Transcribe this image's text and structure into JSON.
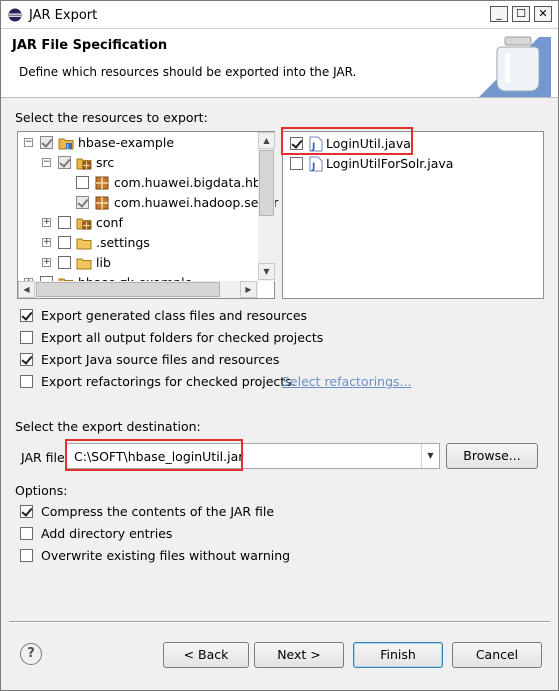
{
  "window": {
    "title": "JAR Export"
  },
  "banner": {
    "title": "JAR File Specification",
    "description": "Define which resources should be exported into the JAR."
  },
  "resources": {
    "label": "Select the resources to export:",
    "tree": [
      {
        "label": "hbase-example",
        "state": "grey-checked",
        "expander": "−",
        "icon": "project-icon"
      },
      {
        "label": "src",
        "state": "grey-checked",
        "expander": "−",
        "icon": "package-folder-icon"
      },
      {
        "label": "com.huawei.bigdata.hbas",
        "state": "unchecked",
        "expander": "",
        "icon": "package-icon"
      },
      {
        "label": "com.huawei.hadoop.secur",
        "state": "grey-checked",
        "expander": "",
        "icon": "package-icon"
      },
      {
        "label": "conf",
        "state": "unchecked",
        "expander": "+",
        "icon": "package-folder-icon"
      },
      {
        "label": ".settings",
        "state": "unchecked",
        "expander": "+",
        "icon": "folder-icon"
      },
      {
        "label": "lib",
        "state": "unchecked",
        "expander": "+",
        "icon": "folder-icon"
      },
      {
        "label": "hbase-zk-example",
        "state": "unchecked",
        "expander": "+",
        "icon": "project-icon"
      }
    ],
    "files": [
      {
        "label": "LoginUtil.java",
        "checked": true
      },
      {
        "label": "LoginUtilForSolr.java",
        "checked": false
      }
    ]
  },
  "options_export": [
    {
      "label": "Export generated class files and resources",
      "checked": true
    },
    {
      "label": "Export all output folders for checked projects",
      "checked": false
    },
    {
      "label": "Export Java source files and resources",
      "checked": true
    },
    {
      "label": "Export refactorings for checked projects.",
      "checked": false,
      "link": "Select refactorings..."
    }
  ],
  "destination": {
    "label": "Select the export destination:",
    "jar_label": "JAR file:",
    "jar_value": "C:\\SOFT\\hbase_loginUtil.jar",
    "browse": "Browse..."
  },
  "options": {
    "label": "Options:",
    "items": [
      {
        "label": "Compress the contents of the JAR file",
        "checked": true
      },
      {
        "label": "Add directory entries",
        "checked": false
      },
      {
        "label": "Overwrite existing files without warning",
        "checked": false
      }
    ]
  },
  "buttons": {
    "help": "?",
    "back": "< Back",
    "next": "Next >",
    "finish": "Finish",
    "cancel": "Cancel"
  },
  "colors": {
    "highlight": "#e0312a",
    "link": "#6a8fc7"
  }
}
